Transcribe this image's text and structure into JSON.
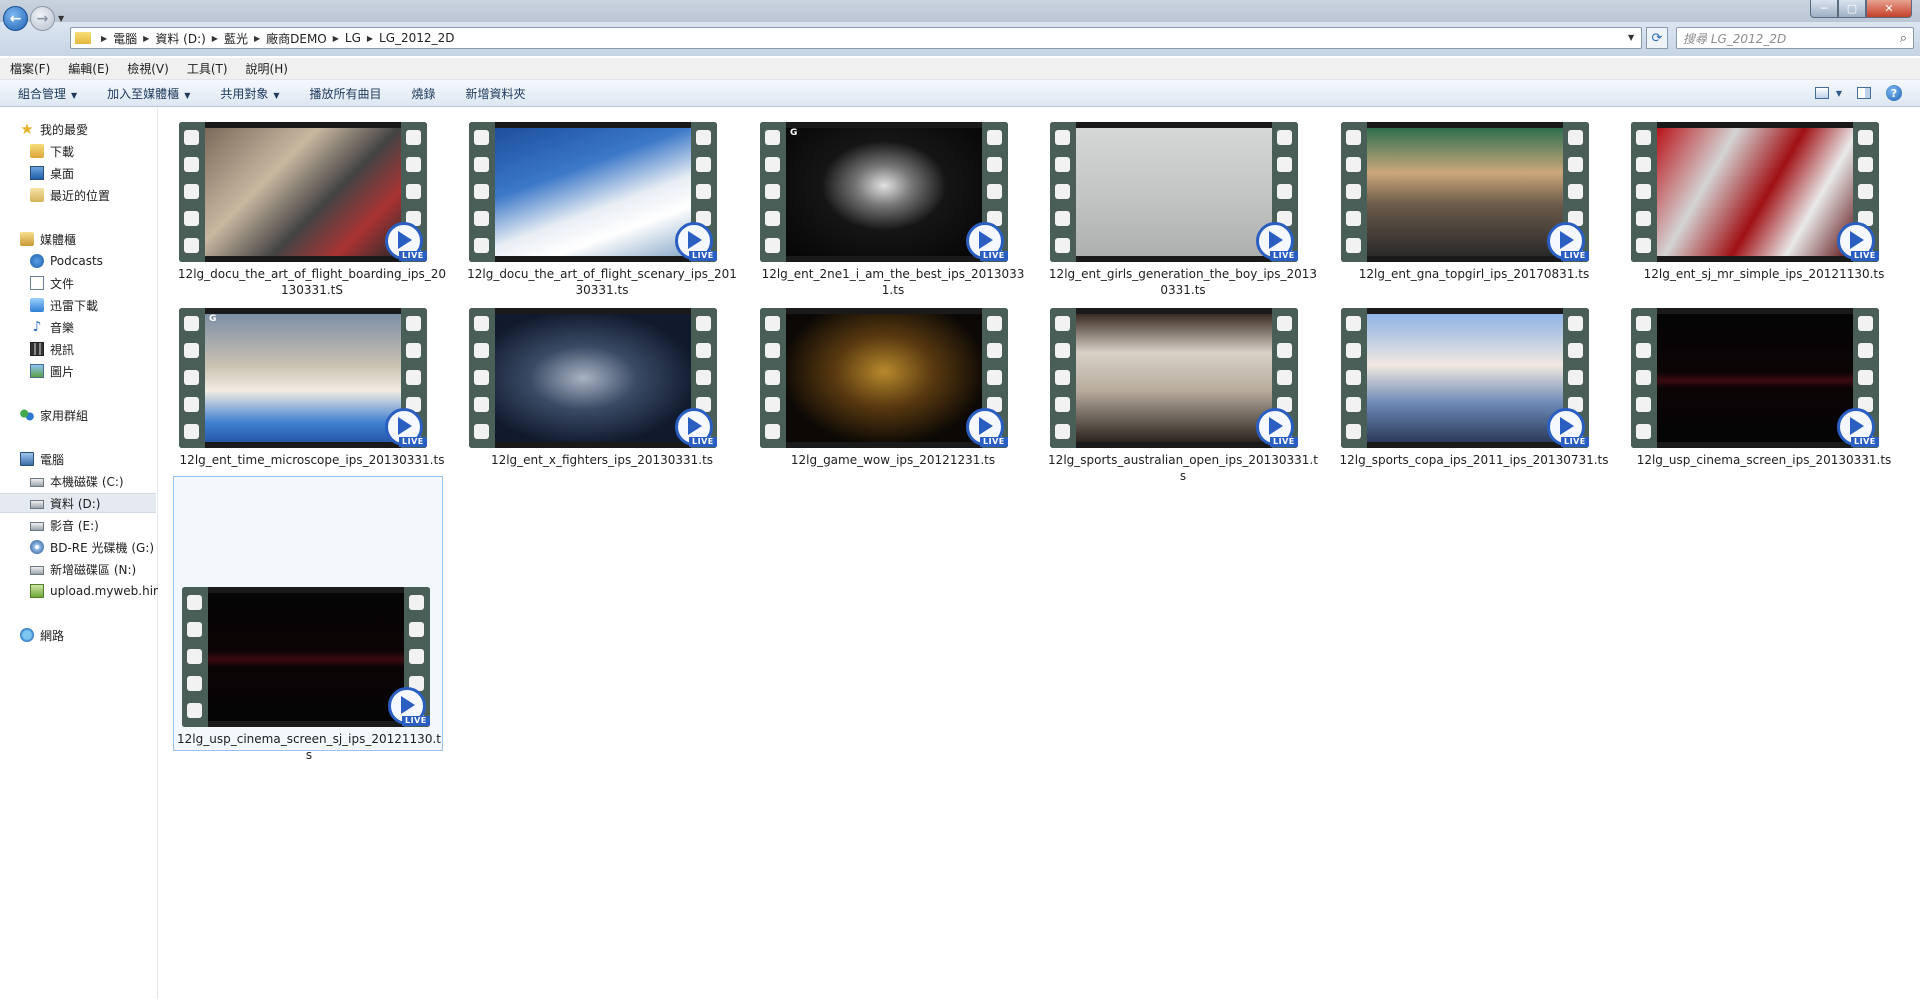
{
  "window": {
    "min_glyph": "─",
    "max_glyph": "▢",
    "close_glyph": "✕"
  },
  "address": {
    "crumbs": [
      "電腦",
      "資料 (D:)",
      "藍光",
      "廠商DEMO",
      "LG",
      "LG_2012_2D"
    ],
    "search_placeholder": "搜尋 LG_2012_2D"
  },
  "menu": [
    "檔案(F)",
    "編輯(E)",
    "檢視(V)",
    "工具(T)",
    "說明(H)"
  ],
  "commands": [
    {
      "label": "組合管理",
      "dropdown": true
    },
    {
      "label": "加入至媒體櫃",
      "dropdown": true
    },
    {
      "label": "共用對象",
      "dropdown": true
    },
    {
      "label": "播放所有曲目",
      "dropdown": false
    },
    {
      "label": "燒錄",
      "dropdown": false
    },
    {
      "label": "新增資料夾",
      "dropdown": false
    }
  ],
  "nav": {
    "favorites": {
      "label": "我的最愛",
      "items": [
        "下載",
        "桌面",
        "最近的位置"
      ]
    },
    "libraries": {
      "label": "媒體櫃",
      "items": [
        "Podcasts",
        "文件",
        "迅雷下載",
        "音樂",
        "視訊",
        "圖片"
      ]
    },
    "homegroup": {
      "label": "家用群組"
    },
    "computer": {
      "label": "電腦",
      "items": [
        "本機磁碟 (C:)",
        "資料 (D:)",
        "影音 (E:)",
        "BD-RE 光碟機 (G:) S",
        "新增磁碟區 (N:)",
        "upload.myweb.hin"
      ]
    },
    "network": {
      "label": "網路"
    }
  },
  "badge_text": "LIVE",
  "files": [
    {
      "name": "12lg_docu_the_art_of_flight_boarding_ips_20130331.tS",
      "g": false
    },
    {
      "name": "12lg_docu_the_art_of_flight_scenary_ips_20130331.ts",
      "g": false
    },
    {
      "name": "12lg_ent_2ne1_i_am_the_best_ips_20130331.ts",
      "g": true
    },
    {
      "name": "12lg_ent_girls_generation_the_boy_ips_20130331.ts",
      "g": false
    },
    {
      "name": "12lg_ent_gna_topgirl_ips_20170831.ts",
      "g": false
    },
    {
      "name": "12lg_ent_sj_mr_simple_ips_20121130.ts",
      "g": false
    },
    {
      "name": "12lg_ent_time_microscope_ips_20130331.ts",
      "g": true
    },
    {
      "name": "12lg_ent_x_fighters_ips_20130331.ts",
      "g": false
    },
    {
      "name": "12lg_game_wow_ips_20121231.ts",
      "g": false
    },
    {
      "name": "12lg_sports_australian_open_ips_20130331.ts",
      "g": false
    },
    {
      "name": "12lg_sports_copa_ips_2011_ips_20130731.ts",
      "g": false
    },
    {
      "name": "12lg_usp_cinema_screen_ips_20130331.ts",
      "g": false
    },
    {
      "name": "12lg_usp_cinema_screen_sj_ips_20121130.ts",
      "g": false
    }
  ]
}
